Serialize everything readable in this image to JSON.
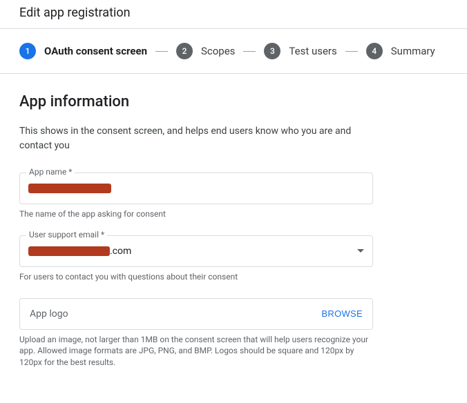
{
  "header": {
    "title": "Edit app registration"
  },
  "stepper": {
    "steps": [
      {
        "num": "1",
        "label": "OAuth consent screen",
        "active": true
      },
      {
        "num": "2",
        "label": "Scopes",
        "active": false
      },
      {
        "num": "3",
        "label": "Test users",
        "active": false
      },
      {
        "num": "4",
        "label": "Summary",
        "active": false
      }
    ]
  },
  "section": {
    "title": "App information",
    "desc": "This shows in the consent screen, and helps end users know who you are and contact you"
  },
  "fields": {
    "app_name": {
      "label": "App name *",
      "value": "",
      "help": "The name of the app asking for consent"
    },
    "support_email": {
      "label": "User support email *",
      "suffix": ".com",
      "help": "For users to contact you with questions about their consent"
    },
    "app_logo": {
      "placeholder": "App logo",
      "browse": "BROWSE",
      "help": "Upload an image, not larger than 1MB on the consent screen that will help users recognize your app. Allowed image formats are JPG, PNG, and BMP. Logos should be square and 120px by 120px for the best results."
    }
  }
}
